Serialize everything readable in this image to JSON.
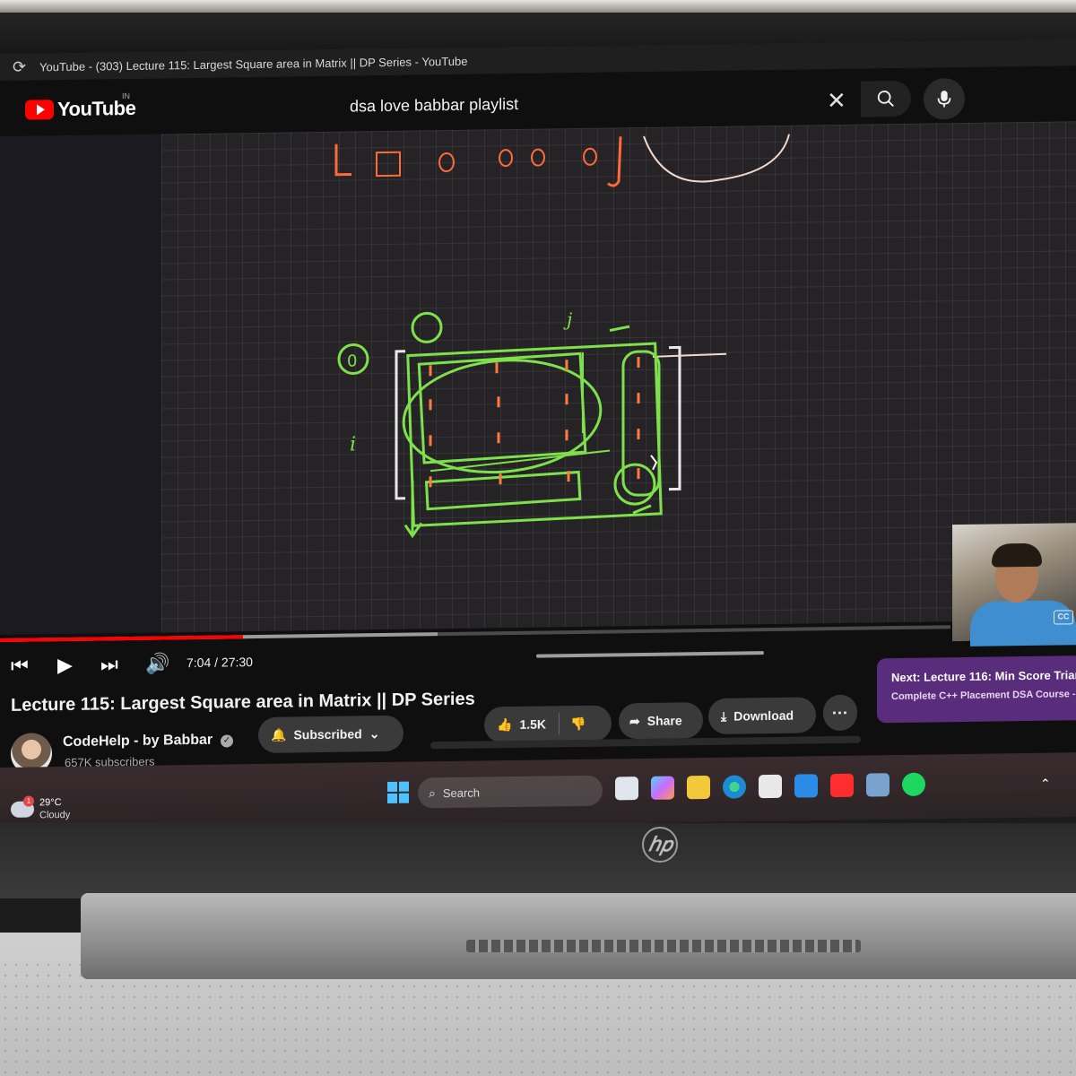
{
  "browser": {
    "tab_title": "YouTube - (303) Lecture 115: Largest Square area in Matrix || DP Series - YouTube"
  },
  "header": {
    "logo_text": "YouTube",
    "country_code": "IN",
    "search_query": "dsa love babbar playlist"
  },
  "player": {
    "current_time": "7:04",
    "duration": "27:30",
    "time_display": "7:04 / 27:30",
    "progress_fraction": 0.256,
    "buffered_fraction": 0.46,
    "cc_label": "CC",
    "drawing_labels": {
      "row_index": "i",
      "col_index": "j",
      "zero_marker": "0"
    }
  },
  "video": {
    "title": "Lecture 115: Largest Square area in Matrix || DP Series"
  },
  "channel": {
    "name": "CodeHelp - by Babbar",
    "subscribers": "657K subscribers",
    "subscribe_state": "Subscribed"
  },
  "actions": {
    "like_count": "1.5K",
    "share_label": "Share",
    "download_label": "Download",
    "more_label": "···"
  },
  "up_next": {
    "title": "Next: Lecture 116: Min Score Trian",
    "subtitle": "Complete C++ Placement DSA Course -"
  },
  "taskbar": {
    "weather_temp": "29°C",
    "weather_desc": "Cloudy",
    "weather_badge": "1",
    "search_label": "Search"
  },
  "laptop": {
    "brand": "hp"
  },
  "colors": {
    "accent": "#ff0000",
    "drawing_green": "#7ee04a",
    "drawing_orange": "#ff7a3c",
    "up_next_bg": "#5a2c7c"
  }
}
